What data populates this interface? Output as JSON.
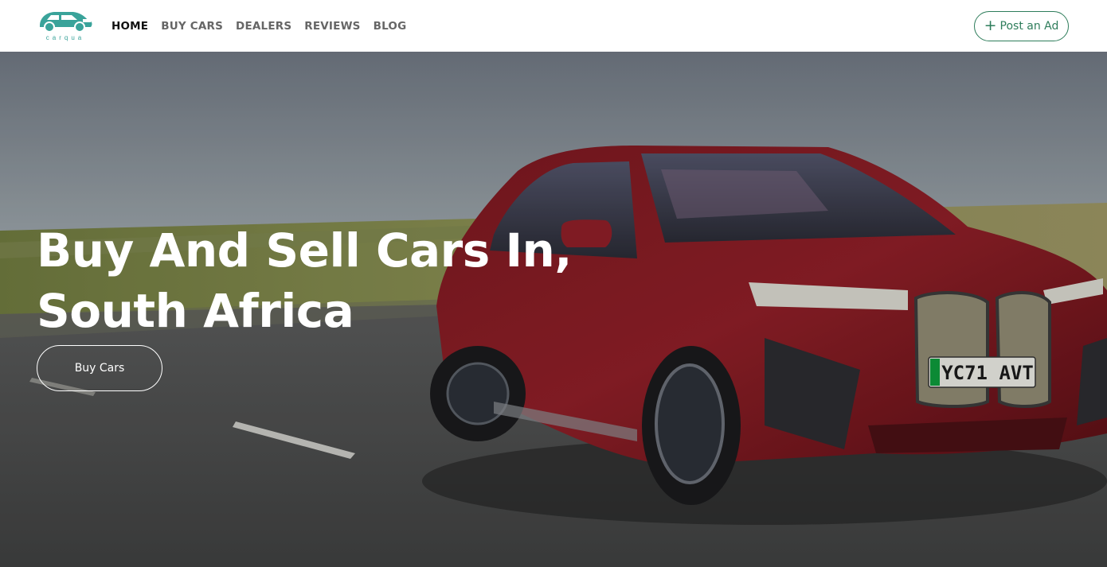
{
  "brand": {
    "name": "carqua",
    "logo_icon": "car-icon",
    "color": "#3aa39a"
  },
  "nav": {
    "links": [
      "HOME",
      "BUY CARS",
      "DEALERS",
      "REVIEWS",
      "BLOG"
    ],
    "active": "HOME"
  },
  "header": {
    "post_ad_label": "Post an Ad",
    "post_ad_icon": "plus-icon",
    "accent": "#2e7d5b"
  },
  "hero": {
    "title_line1": "Buy And Sell Cars In,",
    "title_line2": "South Africa",
    "cta_label": "Buy Cars",
    "image": "red-suv-on-road",
    "plate": "YC71 AVT"
  }
}
